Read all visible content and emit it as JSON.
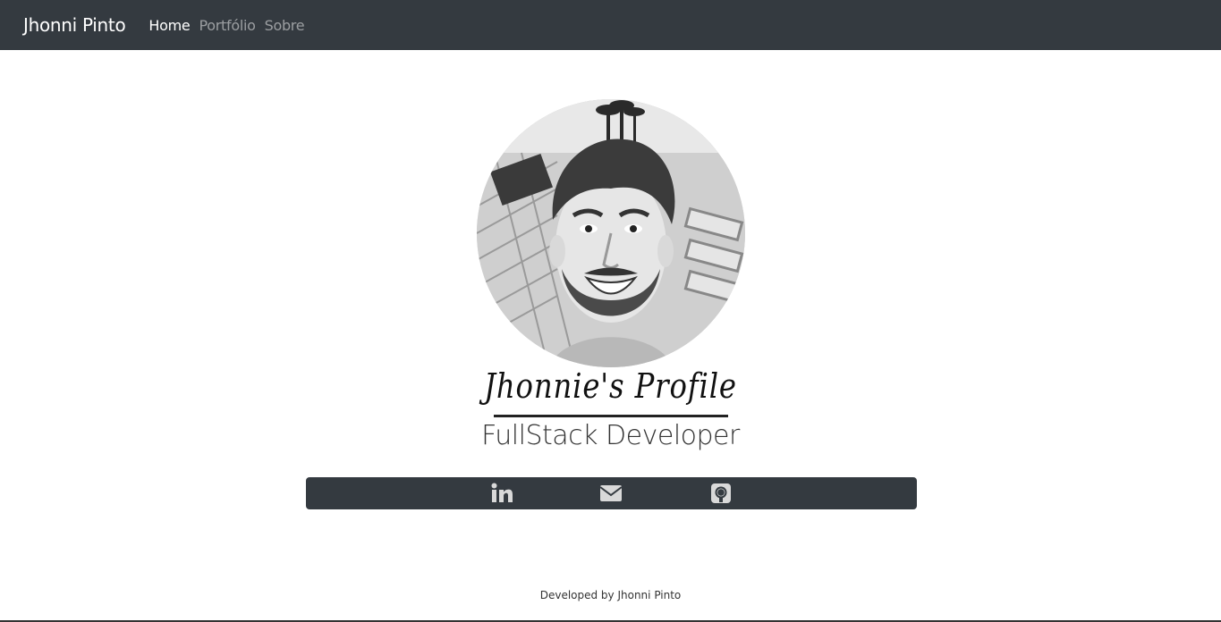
{
  "navbar": {
    "brand": "Jhonni Pinto",
    "links": [
      {
        "label": "Home",
        "active": true
      },
      {
        "label": "Portfólio",
        "active": false
      },
      {
        "label": "Sobre",
        "active": false
      }
    ],
    "background": "#343a40"
  },
  "profile": {
    "title": "Jhonnie's Profile",
    "subtitle": "FullStack Developer"
  },
  "social": {
    "icons": [
      "linkedin-icon",
      "envelope-icon",
      "github-icon"
    ],
    "bar_color": "#343a40",
    "icon_color": "#d9d9d9"
  },
  "footer": {
    "text": "Developed by Jhonni Pinto"
  }
}
